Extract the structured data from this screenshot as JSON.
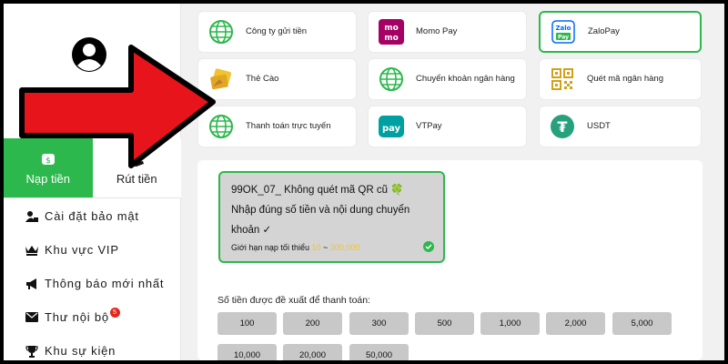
{
  "payment_methods": [
    {
      "id": "cong-ty-gui-tien",
      "label": "Công ty gửi tiền",
      "icon": "globe-icon"
    },
    {
      "id": "momo-pay",
      "label": "Momo Pay",
      "icon": "momo-logo-icon"
    },
    {
      "id": "zalopay",
      "label": "ZaloPay",
      "icon": "zalopay-logo-icon",
      "selected": true
    },
    {
      "id": "the-cao",
      "label": "Thẻ Cào",
      "icon": "scratch-card-icon"
    },
    {
      "id": "chuyen-khoan",
      "label": "Chuyển khoản ngân hàng",
      "icon": "globe-icon"
    },
    {
      "id": "quet-ma",
      "label": "Quét mã ngân hàng",
      "icon": "qr-code-icon"
    },
    {
      "id": "thanh-toan-truc-tuyen",
      "label": "Thanh toán trực tuyến",
      "icon": "globe-icon"
    },
    {
      "id": "vtpay",
      "label": "VTPay",
      "icon": "vtpay-logo-icon"
    },
    {
      "id": "usdt",
      "label": "USDT",
      "icon": "tether-logo-icon"
    }
  ],
  "momo_icon_text": [
    "mo",
    "mo"
  ],
  "zalo_icon_text": [
    "Zalo",
    "Pay"
  ],
  "vtpay_icon_text": "pay",
  "usdt_icon_text": "₮",
  "tabs": {
    "deposit": "Nạp tiền",
    "withdraw": "Rút tiền"
  },
  "menu": [
    {
      "label": "Cài đặt bảo mật",
      "icon": "user-lock-icon"
    },
    {
      "label": "Khu vực VIP",
      "icon": "vip-crown-icon"
    },
    {
      "label": "Thông báo mới nhất",
      "icon": "megaphone-icon"
    },
    {
      "label": "Thư nội bộ",
      "icon": "mail-icon",
      "badge": "5"
    },
    {
      "label": "Khu sự kiện",
      "icon": "trophy-icon"
    }
  ],
  "notice": {
    "line1": "99OK_07_ Không quét mã QR cũ 🍀",
    "line2": "Nhập đúng số tiền và nội dung chuyển",
    "line3": "khoản ✓",
    "limit_label": "Giới hạn nạp tối thiểu",
    "limit_min": "10",
    "limit_sep": "~",
    "limit_max": "300,000"
  },
  "amount_label": "Số tiền được đề xuất để thanh toán:",
  "amounts": [
    "100",
    "200",
    "300",
    "500",
    "1,000",
    "2,000",
    "5,000",
    "10,000",
    "20,000",
    "50,000"
  ],
  "colors": {
    "accent": "#2db84d",
    "arrow": "#e8141b",
    "highlight": "#f2c230"
  }
}
